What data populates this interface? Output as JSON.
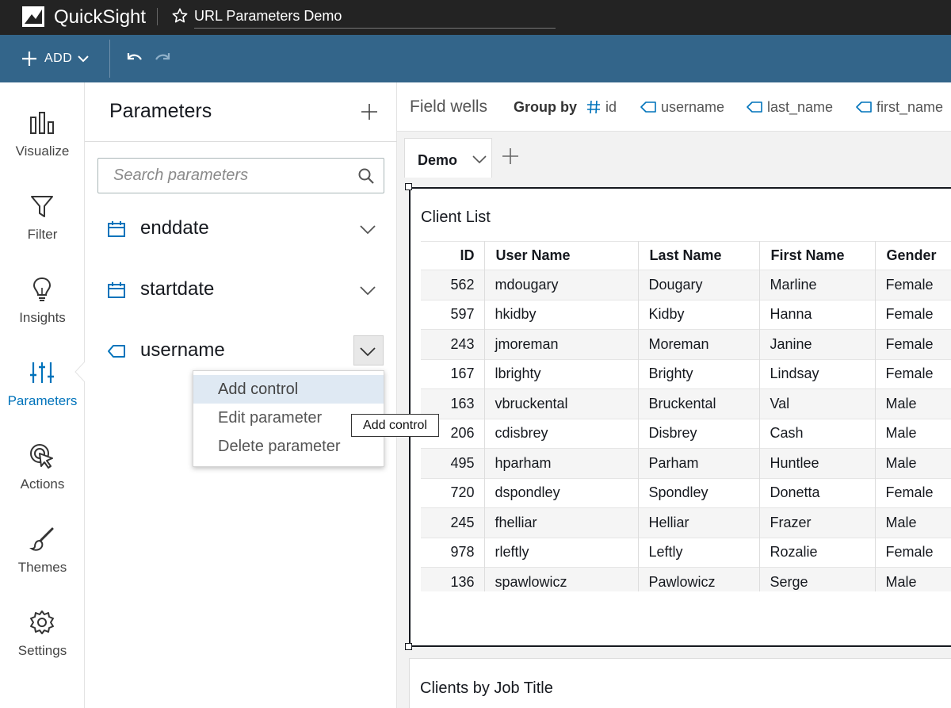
{
  "app": {
    "brand": "QuickSight",
    "analysis_title": "URL Parameters Demo"
  },
  "toolbar": {
    "add_label": "ADD"
  },
  "nav": {
    "items": [
      {
        "label": "Visualize",
        "icon": "bar-chart-icon"
      },
      {
        "label": "Filter",
        "icon": "filter-icon"
      },
      {
        "label": "Insights",
        "icon": "lightbulb-icon"
      },
      {
        "label": "Parameters",
        "icon": "sliders-icon",
        "active": true
      },
      {
        "label": "Actions",
        "icon": "cursor-click-icon"
      },
      {
        "label": "Themes",
        "icon": "brush-icon"
      },
      {
        "label": "Settings",
        "icon": "gear-icon"
      }
    ]
  },
  "parameters_panel": {
    "title": "Parameters",
    "search_placeholder": "Search parameters",
    "items": [
      {
        "name": "enddate",
        "type_icon": "calendar-icon"
      },
      {
        "name": "startdate",
        "type_icon": "calendar-icon"
      },
      {
        "name": "username",
        "type_icon": "tag-icon"
      }
    ],
    "menu": {
      "items": [
        "Add control",
        "Edit parameter",
        "Delete parameter"
      ],
      "highlighted": "Add control"
    },
    "tooltip": "Add control"
  },
  "field_wells": {
    "title": "Field wells",
    "group_by_label": "Group by",
    "fields": [
      "id",
      "username",
      "last_name",
      "first_name"
    ]
  },
  "sheet_tab": {
    "label": "Demo"
  },
  "visual": {
    "title": "Client List",
    "columns": [
      "ID",
      "User Name",
      "Last Name",
      "First Name",
      "Gender"
    ],
    "rows": [
      [
        "562",
        "mdougary",
        "Dougary",
        "Marline",
        "Female"
      ],
      [
        "597",
        "hkidby",
        "Kidby",
        "Hanna",
        "Female"
      ],
      [
        "243",
        "jmoreman",
        "Moreman",
        "Janine",
        "Female"
      ],
      [
        "167",
        "lbrighty",
        "Brighty",
        "Lindsay",
        "Female"
      ],
      [
        "163",
        "vbruckental",
        "Bruckental",
        "Val",
        "Male"
      ],
      [
        "206",
        "cdisbrey",
        "Disbrey",
        "Cash",
        "Male"
      ],
      [
        "495",
        "hparham",
        "Parham",
        "Huntlee",
        "Male"
      ],
      [
        "720",
        "dspondley",
        "Spondley",
        "Donetta",
        "Female"
      ],
      [
        "245",
        "fhelliar",
        "Helliar",
        "Frazer",
        "Male"
      ],
      [
        "978",
        "rleftly",
        "Leftly",
        "Rozalie",
        "Female"
      ],
      [
        "136",
        "spawlowicz",
        "Pawlowicz",
        "Serge",
        "Male"
      ]
    ]
  },
  "visual2": {
    "title": "Clients by Job Title"
  },
  "colors": {
    "topbar": "#232323",
    "toolbar": "#33658a",
    "accent": "#0073bb"
  }
}
